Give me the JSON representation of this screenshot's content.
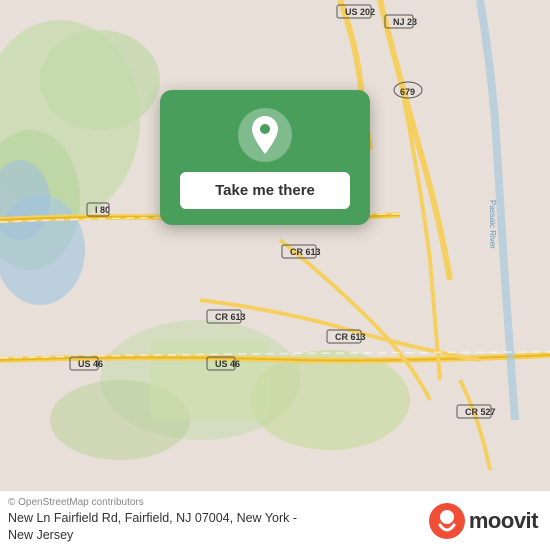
{
  "map": {
    "background_color": "#e8e0d8",
    "center_lat": 40.88,
    "center_lng": -74.3
  },
  "card": {
    "background_color": "#4a9e5c",
    "pin_icon": "location-pin",
    "button_label": "Take me there"
  },
  "footer": {
    "osm_credit": "© OpenStreetMap contributors",
    "address_line1": "New Ln Fairfield Rd, Fairfield, NJ 07004, New York -",
    "address_line2": "New Jersey",
    "brand_name": "moovit"
  }
}
